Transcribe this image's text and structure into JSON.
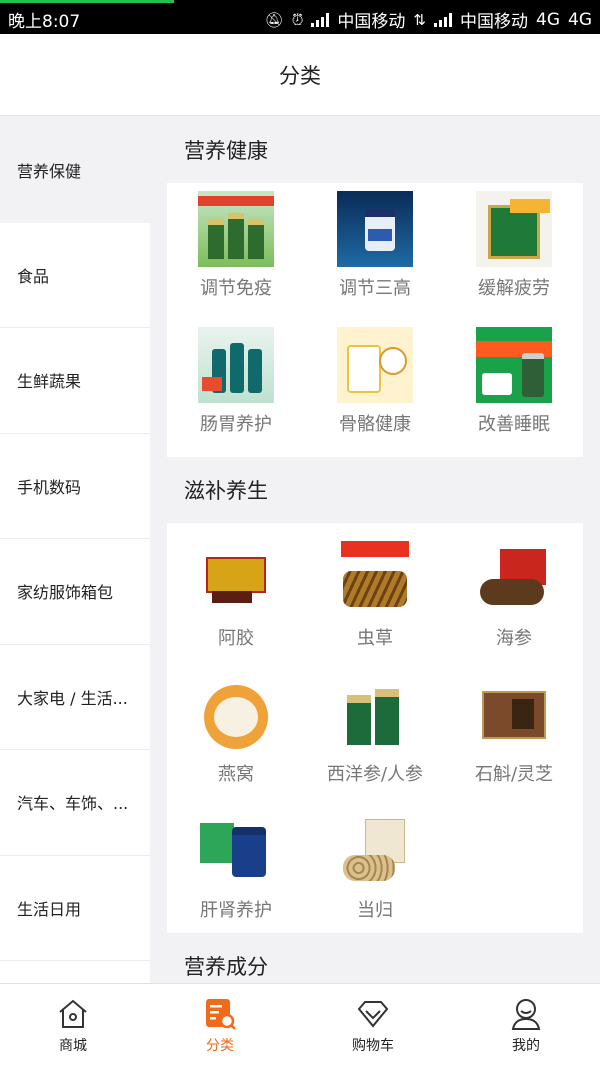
{
  "status_bar": {
    "time": "晚上8:07",
    "carrier1": "中国移动",
    "carrier2": "中国移动",
    "network1": "4G",
    "network2": "4G"
  },
  "header": {
    "title": "分类"
  },
  "sidebar": {
    "items": [
      {
        "label": "营养保健",
        "active": true
      },
      {
        "label": "食品"
      },
      {
        "label": "生鲜蔬果"
      },
      {
        "label": "手机数码"
      },
      {
        "label": "家纺服饰箱包"
      },
      {
        "label": "大家电 / 生活..."
      },
      {
        "label": "汽车、车饰、..."
      },
      {
        "label": "生活日用"
      }
    ]
  },
  "sections": [
    {
      "title": "营养健康",
      "items": [
        {
          "label": "调节免疫",
          "icon": "immune-product-icon"
        },
        {
          "label": "调节三高",
          "icon": "omega3-product-icon"
        },
        {
          "label": "缓解疲劳",
          "icon": "anti-fatigue-product-icon"
        },
        {
          "label": "肠胃养护",
          "icon": "probiotic-product-icon"
        },
        {
          "label": "骨骼健康",
          "icon": "calcium-product-icon"
        },
        {
          "label": "改善睡眠",
          "icon": "melatonin-product-icon"
        }
      ]
    },
    {
      "title": "滋补养生",
      "items": [
        {
          "label": "阿胶",
          "icon": "ejiao-product-icon"
        },
        {
          "label": "虫草",
          "icon": "cordyceps-product-icon"
        },
        {
          "label": "海参",
          "icon": "sea-cucumber-product-icon"
        },
        {
          "label": "燕窝",
          "icon": "birds-nest-product-icon"
        },
        {
          "label": "西洋参/人参",
          "icon": "ginseng-product-icon"
        },
        {
          "label": "石斛/灵芝",
          "icon": "dendrobium-product-icon"
        },
        {
          "label": "肝肾养护",
          "icon": "liver-kidney-product-icon"
        },
        {
          "label": "当归",
          "icon": "angelica-product-icon"
        }
      ]
    },
    {
      "title": "营养成分"
    }
  ],
  "tabbar": {
    "items": [
      {
        "label": "商城",
        "icon": "home-icon"
      },
      {
        "label": "分类",
        "icon": "category-icon",
        "active": true
      },
      {
        "label": "购物车",
        "icon": "diamond-cart-icon"
      },
      {
        "label": "我的",
        "icon": "profile-icon"
      }
    ]
  },
  "colors": {
    "accent": "#f06a1a",
    "background": "#f2f2f5",
    "progress": "#23c04a"
  }
}
